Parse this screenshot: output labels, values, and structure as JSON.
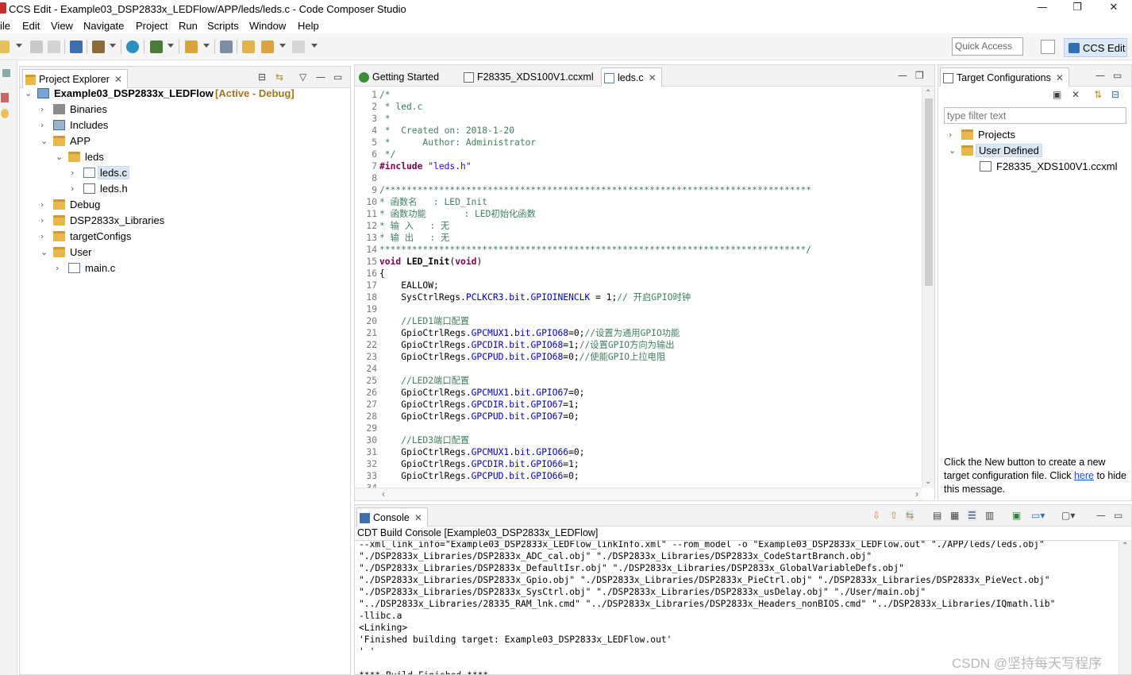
{
  "window": {
    "title": "CCS Edit - Example03_DSP2833x_LEDFlow/APP/leds/leds.c - Code Composer Studio",
    "minimize": "—",
    "maximize": "❐",
    "close": "✕"
  },
  "menu": [
    "ile",
    "Edit",
    "View",
    "Navigate",
    "Project",
    "Run",
    "Scripts",
    "Window",
    "Help"
  ],
  "quick_access": {
    "placeholder": "Quick Access"
  },
  "perspective": {
    "label": "CCS Edit"
  },
  "project_explorer": {
    "tab_label": "Project Explorer",
    "project": {
      "name": "Example03_DSP2833x_LEDFlow",
      "status": "[Active - Debug]"
    },
    "items": [
      {
        "label": "Binaries",
        "icon": "binaries-icon",
        "arrow": "›"
      },
      {
        "label": "Includes",
        "icon": "includes-icon",
        "arrow": "›"
      },
      {
        "label": "APP",
        "icon": "folder-icon",
        "arrow": "⌄"
      },
      {
        "label": "leds",
        "icon": "folder-open-icon",
        "arrow": "⌄"
      },
      {
        "label": "leds.c",
        "icon": "c-file-icon",
        "arrow": "›",
        "selected": true
      },
      {
        "label": "leds.h",
        "icon": "h-file-icon",
        "arrow": "›"
      },
      {
        "label": "Debug",
        "icon": "folder-icon",
        "arrow": "›"
      },
      {
        "label": "DSP2833x_Libraries",
        "icon": "folder-icon",
        "arrow": "›"
      },
      {
        "label": "targetConfigs",
        "icon": "folder-icon",
        "arrow": "›"
      },
      {
        "label": "User",
        "icon": "folder-icon",
        "arrow": "⌄"
      },
      {
        "label": "main.c",
        "icon": "c-file-icon",
        "arrow": "›"
      }
    ]
  },
  "editor": {
    "tabs": [
      {
        "label": "Getting Started"
      },
      {
        "label": "F28335_XDS100V1.ccxml"
      },
      {
        "label": "leds.c",
        "active": true
      }
    ],
    "lines": [
      {
        "n": "1",
        "parts": [
          {
            "t": "/*",
            "c": "cm"
          }
        ]
      },
      {
        "n": "2",
        "parts": [
          {
            "t": " * led.c",
            "c": "cm"
          }
        ]
      },
      {
        "n": "3",
        "parts": [
          {
            "t": " *",
            "c": "cm"
          }
        ]
      },
      {
        "n": "4",
        "parts": [
          {
            "t": " *  Created on: 2018-1-20",
            "c": "cm"
          }
        ]
      },
      {
        "n": "5",
        "parts": [
          {
            "t": " *      Author: Administrator",
            "c": "cm"
          }
        ]
      },
      {
        "n": "6",
        "parts": [
          {
            "t": " */",
            "c": "cm"
          }
        ]
      },
      {
        "n": "7",
        "parts": [
          {
            "t": "#include ",
            "c": "kw"
          },
          {
            "t": "\"leds.h\"",
            "c": "str"
          }
        ]
      },
      {
        "n": "8",
        "parts": [
          {
            "t": "",
            "c": ""
          }
        ]
      },
      {
        "n": "9",
        "parts": [
          {
            "t": "/*******************************************************************************",
            "c": "cm"
          }
        ]
      },
      {
        "n": "10",
        "parts": [
          {
            "t": "* 函数名   : LED_Init",
            "c": "cm"
          }
        ]
      },
      {
        "n": "11",
        "parts": [
          {
            "t": "* 函数功能       : LED初始化函数",
            "c": "cm"
          }
        ]
      },
      {
        "n": "12",
        "parts": [
          {
            "t": "* 输 入   : 无",
            "c": "cm"
          }
        ]
      },
      {
        "n": "13",
        "parts": [
          {
            "t": "* 输 出   : 无",
            "c": "cm"
          }
        ]
      },
      {
        "n": "14",
        "parts": [
          {
            "t": "*******************************************************************************/",
            "c": "cm"
          }
        ]
      },
      {
        "n": "15",
        "parts": [
          {
            "t": "void ",
            "c": "kw"
          },
          {
            "t": "LED_Init",
            "c": "b"
          },
          {
            "t": "(",
            "c": ""
          },
          {
            "t": "void",
            "c": "kw"
          },
          {
            "t": ")",
            "c": ""
          }
        ]
      },
      {
        "n": "16",
        "parts": [
          {
            "t": "{",
            "c": ""
          }
        ]
      },
      {
        "n": "17",
        "parts": [
          {
            "t": "    EALLOW;",
            "c": ""
          }
        ]
      },
      {
        "n": "18",
        "parts": [
          {
            "t": "    SysCtrlRegs.",
            "c": ""
          },
          {
            "t": "PCLKCR3",
            "c": "fld"
          },
          {
            "t": ".",
            "c": ""
          },
          {
            "t": "bit",
            "c": "fld"
          },
          {
            "t": ".",
            "c": ""
          },
          {
            "t": "GPIOINENCLK",
            "c": "fld"
          },
          {
            "t": " = 1;",
            "c": ""
          },
          {
            "t": "// 开启GPIO时钟",
            "c": "cm"
          }
        ]
      },
      {
        "n": "19",
        "parts": [
          {
            "t": "",
            "c": ""
          }
        ]
      },
      {
        "n": "20",
        "parts": [
          {
            "t": "    ",
            "c": ""
          },
          {
            "t": "//LED1端口配置",
            "c": "cm"
          }
        ]
      },
      {
        "n": "21",
        "parts": [
          {
            "t": "    GpioCtrlRegs.",
            "c": ""
          },
          {
            "t": "GPCMUX1",
            "c": "fld"
          },
          {
            "t": ".",
            "c": ""
          },
          {
            "t": "bit",
            "c": "fld"
          },
          {
            "t": ".",
            "c": ""
          },
          {
            "t": "GPIO68",
            "c": "fld"
          },
          {
            "t": "=0;",
            "c": ""
          },
          {
            "t": "//设置为通用GPIO功能",
            "c": "cm"
          }
        ]
      },
      {
        "n": "22",
        "parts": [
          {
            "t": "    GpioCtrlRegs.",
            "c": ""
          },
          {
            "t": "GPCDIR",
            "c": "fld"
          },
          {
            "t": ".",
            "c": ""
          },
          {
            "t": "bit",
            "c": "fld"
          },
          {
            "t": ".",
            "c": ""
          },
          {
            "t": "GPIO68",
            "c": "fld"
          },
          {
            "t": "=1;",
            "c": ""
          },
          {
            "t": "//设置GPIO方向为输出",
            "c": "cm"
          }
        ]
      },
      {
        "n": "23",
        "parts": [
          {
            "t": "    GpioCtrlRegs.",
            "c": ""
          },
          {
            "t": "GPCPUD",
            "c": "fld"
          },
          {
            "t": ".",
            "c": ""
          },
          {
            "t": "bit",
            "c": "fld"
          },
          {
            "t": ".",
            "c": ""
          },
          {
            "t": "GPIO68",
            "c": "fld"
          },
          {
            "t": "=0;",
            "c": ""
          },
          {
            "t": "//使能GPIO上拉电阻",
            "c": "cm"
          }
        ]
      },
      {
        "n": "24",
        "parts": [
          {
            "t": "",
            "c": ""
          }
        ]
      },
      {
        "n": "25",
        "parts": [
          {
            "t": "    ",
            "c": ""
          },
          {
            "t": "//LED2端口配置",
            "c": "cm"
          }
        ]
      },
      {
        "n": "26",
        "parts": [
          {
            "t": "    GpioCtrlRegs.",
            "c": ""
          },
          {
            "t": "GPCMUX1",
            "c": "fld"
          },
          {
            "t": ".",
            "c": ""
          },
          {
            "t": "bit",
            "c": "fld"
          },
          {
            "t": ".",
            "c": ""
          },
          {
            "t": "GPIO67",
            "c": "fld"
          },
          {
            "t": "=0;",
            "c": ""
          }
        ]
      },
      {
        "n": "27",
        "parts": [
          {
            "t": "    GpioCtrlRegs.",
            "c": ""
          },
          {
            "t": "GPCDIR",
            "c": "fld"
          },
          {
            "t": ".",
            "c": ""
          },
          {
            "t": "bit",
            "c": "fld"
          },
          {
            "t": ".",
            "c": ""
          },
          {
            "t": "GPIO67",
            "c": "fld"
          },
          {
            "t": "=1;",
            "c": ""
          }
        ]
      },
      {
        "n": "28",
        "parts": [
          {
            "t": "    GpioCtrlRegs.",
            "c": ""
          },
          {
            "t": "GPCPUD",
            "c": "fld"
          },
          {
            "t": ".",
            "c": ""
          },
          {
            "t": "bit",
            "c": "fld"
          },
          {
            "t": ".",
            "c": ""
          },
          {
            "t": "GPIO67",
            "c": "fld"
          },
          {
            "t": "=0;",
            "c": ""
          }
        ]
      },
      {
        "n": "29",
        "parts": [
          {
            "t": "",
            "c": ""
          }
        ]
      },
      {
        "n": "30",
        "parts": [
          {
            "t": "    ",
            "c": ""
          },
          {
            "t": "//LED3端口配置",
            "c": "cm"
          }
        ]
      },
      {
        "n": "31",
        "parts": [
          {
            "t": "    GpioCtrlRegs.",
            "c": ""
          },
          {
            "t": "GPCMUX1",
            "c": "fld"
          },
          {
            "t": ".",
            "c": ""
          },
          {
            "t": "bit",
            "c": "fld"
          },
          {
            "t": ".",
            "c": ""
          },
          {
            "t": "GPIO66",
            "c": "fld"
          },
          {
            "t": "=0;",
            "c": ""
          }
        ]
      },
      {
        "n": "32",
        "parts": [
          {
            "t": "    GpioCtrlRegs.",
            "c": ""
          },
          {
            "t": "GPCDIR",
            "c": "fld"
          },
          {
            "t": ".",
            "c": ""
          },
          {
            "t": "bit",
            "c": "fld"
          },
          {
            "t": ".",
            "c": ""
          },
          {
            "t": "GPIO66",
            "c": "fld"
          },
          {
            "t": "=1;",
            "c": ""
          }
        ]
      },
      {
        "n": "33",
        "parts": [
          {
            "t": "    GpioCtrlRegs.",
            "c": ""
          },
          {
            "t": "GPCPUD",
            "c": "fld"
          },
          {
            "t": ".",
            "c": ""
          },
          {
            "t": "bit",
            "c": "fld"
          },
          {
            "t": ".",
            "c": ""
          },
          {
            "t": "GPIO66",
            "c": "fld"
          },
          {
            "t": "=0;",
            "c": ""
          }
        ]
      },
      {
        "n": "34",
        "parts": [
          {
            "t": "",
            "c": ""
          }
        ]
      }
    ]
  },
  "target_configs": {
    "tab_label": "Target Configurations",
    "filter_placeholder": "type filter text",
    "items": [
      {
        "label": "Projects",
        "arrow": "›"
      },
      {
        "label": "User Defined",
        "arrow": "⌄",
        "selected": true
      },
      {
        "label": "F28335_XDS100V1.ccxml"
      }
    ],
    "message_before": "Click the New button to create a new target configuration file. Click ",
    "message_link": "here",
    "message_after": " to hide this message."
  },
  "console": {
    "tab_label": "Console",
    "heading": "CDT Build Console [Example03_DSP2833x_LEDFlow]",
    "lines": [
      "--xml_link_info=\"Example03_DSP2833x_LEDFlow_linkInfo.xml\" --rom_model -o \"Example03_DSP2833x_LEDFlow.out\" \"./APP/leds/leds.obj\"",
      "\"./DSP2833x_Libraries/DSP2833x_ADC_cal.obj\" \"./DSP2833x_Libraries/DSP2833x_CodeStartBranch.obj\"",
      "\"./DSP2833x_Libraries/DSP2833x_DefaultIsr.obj\" \"./DSP2833x_Libraries/DSP2833x_GlobalVariableDefs.obj\"",
      "\"./DSP2833x_Libraries/DSP2833x_Gpio.obj\" \"./DSP2833x_Libraries/DSP2833x_PieCtrl.obj\" \"./DSP2833x_Libraries/DSP2833x_PieVect.obj\"",
      "\"./DSP2833x_Libraries/DSP2833x_SysCtrl.obj\" \"./DSP2833x_Libraries/DSP2833x_usDelay.obj\" \"./User/main.obj\"",
      "\"../DSP2833x_Libraries/28335_RAM_lnk.cmd\" \"../DSP2833x_Libraries/DSP2833x_Headers_nonBIOS.cmd\" \"../DSP2833x_Libraries/IQmath.lib\"",
      "-llibc.a",
      "<Linking>",
      "'Finished building target: Example03_DSP2833x_LEDFlow.out'",
      "' '",
      "",
      "**** Build Finished ****"
    ]
  },
  "watermark": "CSDN @坚持每天写程序",
  "colors": {
    "keyword": "#7f0055",
    "comment": "#3f7f5f",
    "string": "#2a00ff",
    "field": "#0000c0",
    "selection": "#dbe6f3"
  }
}
